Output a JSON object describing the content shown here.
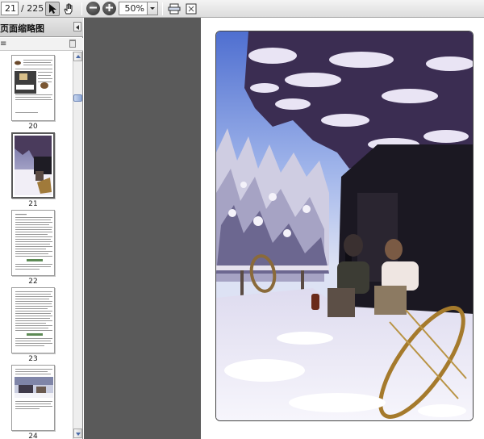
{
  "toolbar": {
    "current_page": "21",
    "page_total": "/ 225",
    "zoom": "50%",
    "icons": [
      "select-arrow-icon",
      "hand-icon",
      "zoom-out-icon",
      "zoom-in-icon",
      "fit-width-icon",
      "fit-page-icon"
    ]
  },
  "panel": {
    "title": "页面缩略图",
    "options_glyph": "≡",
    "thumbnails": [
      {
        "label": "20"
      },
      {
        "label": "21"
      },
      {
        "label": "22"
      },
      {
        "label": "23"
      },
      {
        "label": "24"
      }
    ]
  },
  "colors": {
    "toolbar_bg": "#e2e2e2",
    "doc_bg": "#5a5a5a",
    "accent": "#6d86b8"
  }
}
